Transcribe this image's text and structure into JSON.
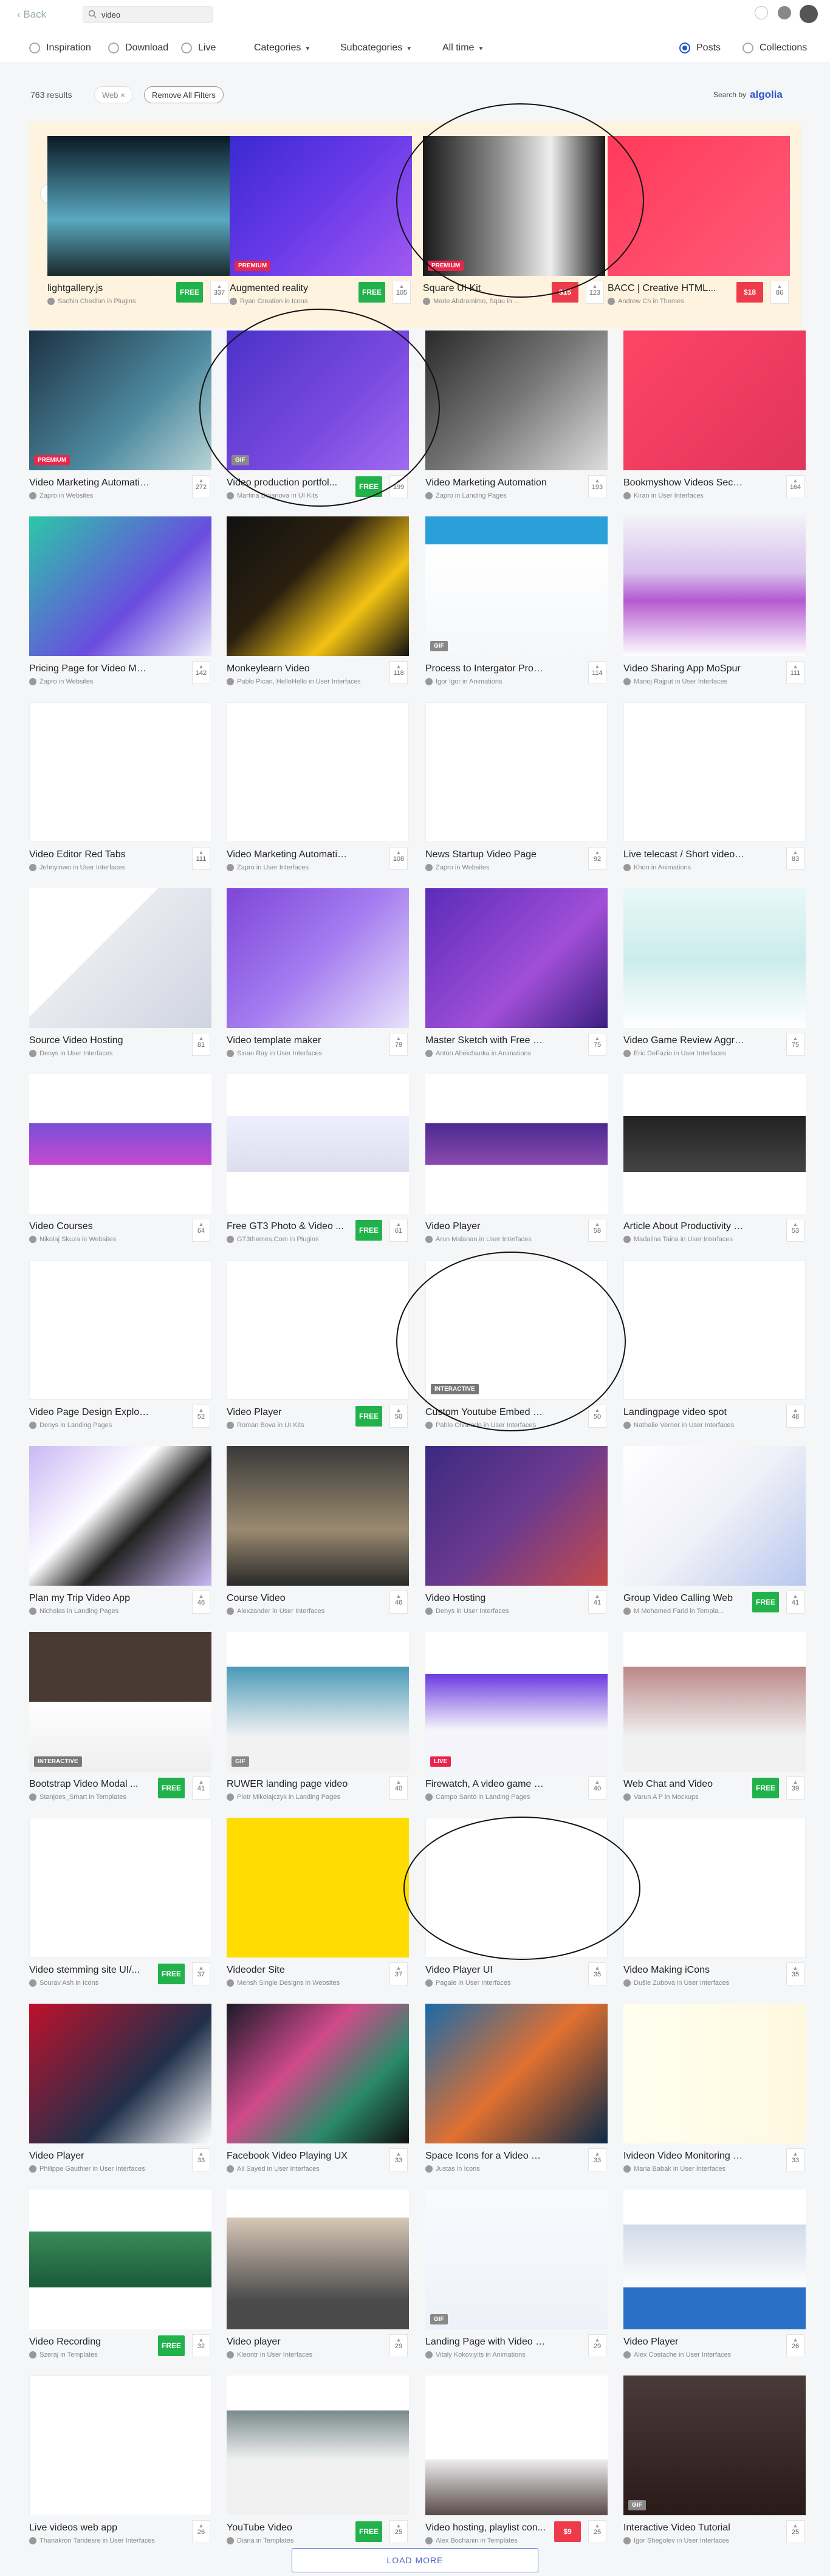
{
  "topbar": {
    "back": "Back",
    "search_value": "video"
  },
  "filters": {
    "radios": [
      "Inspiration",
      "Download",
      "Live"
    ],
    "dropdowns": [
      "Categories",
      "Subcategories",
      "All time"
    ],
    "view": [
      "Posts",
      "Collections"
    ]
  },
  "results": {
    "count": "763 results",
    "chip_web": "Web ×",
    "remove_all": "Remove All Filters",
    "search_by": "Search by",
    "algolia": "algolia"
  },
  "featured": [
    {
      "title": "lightgallery.js",
      "author": "Sachin Chedlon in Plugins",
      "tag": "FREE",
      "votes": "337",
      "badge": ""
    },
    {
      "title": "Augmented reality",
      "author": "Ryan Creation in Icons",
      "tag": "FREE",
      "votes": "105",
      "badge": "PREMIUM"
    },
    {
      "title": "Square UI Kit",
      "author": "Marie Abdramimo, Sqau in ...",
      "tag": "$15",
      "votes": "123",
      "badge": "PREMIUM"
    },
    {
      "title": "BACC | Creative HTML...",
      "author": "Andrew Ch in Themes",
      "tag": "$18",
      "votes": "86",
      "badge": ""
    }
  ],
  "cards": [
    {
      "title": "Video Marketing Automation – F...",
      "author": "Zapro in Websites",
      "tag": "",
      "votes": "272",
      "badge": "PREMIUM"
    },
    {
      "title": "Video production portfol...",
      "author": "Martina Dojanova in UI Kits",
      "tag": "FREE",
      "votes": "199",
      "badge": "GIF"
    },
    {
      "title": "Video Marketing Automation",
      "author": "Zapro in Landing Pages",
      "tag": "",
      "votes": "193",
      "badge": ""
    },
    {
      "title": "Bookmyshow Videos Section",
      "author": "Kiran in User Interfaces",
      "tag": "",
      "votes": "164",
      "badge": ""
    },
    {
      "title": "Pricing Page for Video Marketin...",
      "author": "Zapro in Websites",
      "tag": "",
      "votes": "142",
      "badge": ""
    },
    {
      "title": "Monkeylearn Video",
      "author": "Pablo Picari, HelloHello in User Interfaces",
      "tag": "",
      "votes": "118",
      "badge": ""
    },
    {
      "title": "Process to Intergator Promo Vid...",
      "author": "Igor Igor in Animations",
      "tag": "",
      "votes": "114",
      "badge": "GIF"
    },
    {
      "title": "Video Sharing App MoSpur",
      "author": "Manoj Rajput in User Interfaces",
      "tag": "",
      "votes": "111",
      "badge": ""
    },
    {
      "title": "Video Editor Red Tabs",
      "author": "Johnyinwo in User Interfaces",
      "tag": "",
      "votes": "111",
      "badge": ""
    },
    {
      "title": "Video Marketing Automation an...",
      "author": "Zapro in User Interfaces",
      "tag": "",
      "votes": "108",
      "badge": ""
    },
    {
      "title": "News Startup Video Page",
      "author": "Zapro in Websites",
      "tag": "",
      "votes": "92",
      "badge": ""
    },
    {
      "title": "Live telecast / Short video live A...",
      "author": "Khon in Animations",
      "tag": "",
      "votes": "83",
      "badge": ""
    },
    {
      "title": "Source Video Hosting",
      "author": "Denys in User Interfaces",
      "tag": "",
      "votes": "81",
      "badge": ""
    },
    {
      "title": "Video template maker",
      "author": "Sinan Ray in User Interfaces",
      "tag": "",
      "votes": "79",
      "badge": ""
    },
    {
      "title": "Master Sketch with Free Video T...",
      "author": "Anton Aheichanka in Animations",
      "tag": "",
      "votes": "75",
      "badge": ""
    },
    {
      "title": "Video Game Review Aggregator",
      "author": "Eric DeFazio in User Interfaces",
      "tag": "",
      "votes": "75",
      "badge": ""
    },
    {
      "title": "Video Courses",
      "author": "Nikolaj Skuza in Websites",
      "tag": "",
      "votes": "64",
      "badge": ""
    },
    {
      "title": "Free GT3 Photo & Video ...",
      "author": "GT3themes.Com in Plugins",
      "tag": "FREE",
      "votes": "61",
      "badge": ""
    },
    {
      "title": "Video Player",
      "author": "Arun Malanan in User Interfaces",
      "tag": "",
      "votes": "58",
      "badge": ""
    },
    {
      "title": "Article About Productivity With V...",
      "author": "Madalina Taina in User Interfaces",
      "tag": "",
      "votes": "53",
      "badge": ""
    },
    {
      "title": "Video Page Design Exploration",
      "author": "Denys in Landing Pages",
      "tag": "",
      "votes": "52",
      "badge": ""
    },
    {
      "title": "Video Player",
      "author": "Roman Bova in UI Kits",
      "tag": "FREE",
      "votes": "50",
      "badge": ""
    },
    {
      "title": "Custom Youtube Embed Video P...",
      "author": "Pablo Olvarado in User Interfaces",
      "tag": "",
      "votes": "50",
      "badge": "INTERACTIVE"
    },
    {
      "title": "Landingpage video spot",
      "author": "Nathalie Verner in User Interfaces",
      "tag": "",
      "votes": "48",
      "badge": ""
    },
    {
      "title": "Plan my Trip Video App",
      "author": "Nicholas in Landing Pages",
      "tag": "",
      "votes": "46",
      "badge": ""
    },
    {
      "title": "Course Video",
      "author": "Alexzander in User Interfaces",
      "tag": "",
      "votes": "46",
      "badge": ""
    },
    {
      "title": "Video Hosting",
      "author": "Denys in User Interfaces",
      "tag": "",
      "votes": "41",
      "badge": ""
    },
    {
      "title": "Group Video Calling Web",
      "author": "M Mohamed Farid in Templa...",
      "tag": "FREE",
      "votes": "41",
      "badge": ""
    },
    {
      "title": "Bootstrap Video Modal ...",
      "author": "Stanjoes_Smart in Templates",
      "tag": "FREE",
      "votes": "41",
      "badge": "INTERACTIVE"
    },
    {
      "title": "RUWER landing page video",
      "author": "Piotr Mikolajczyk in Landing Pages",
      "tag": "",
      "votes": "40",
      "badge": "GIF"
    },
    {
      "title": "Firewatch, A video game by cam...",
      "author": "Campo Santo in Landing Pages",
      "tag": "",
      "votes": "40",
      "badge": "LIVE"
    },
    {
      "title": "Web Chat and Video",
      "author": "Varun A P in Mockups",
      "tag": "FREE",
      "votes": "39",
      "badge": ""
    },
    {
      "title": "Video stemming site UI/...",
      "author": "Sourav Ash in Icons",
      "tag": "FREE",
      "votes": "37",
      "badge": ""
    },
    {
      "title": "Videoder Site",
      "author": "Mensh Single Designs in Websites",
      "tag": "",
      "votes": "37",
      "badge": ""
    },
    {
      "title": "Video Player UI",
      "author": "Pagale in User Interfaces",
      "tag": "",
      "votes": "35",
      "badge": ""
    },
    {
      "title": "Video Making iCons",
      "author": "Dušle Zubova in User Interfaces",
      "tag": "",
      "votes": "35",
      "badge": ""
    },
    {
      "title": "Video Player",
      "author": "Philippe Gauthier in User Interfaces",
      "tag": "",
      "votes": "33",
      "badge": ""
    },
    {
      "title": "Facebook Video Playing UX",
      "author": "Ali Sayed in User Interfaces",
      "tag": "",
      "votes": "33",
      "badge": ""
    },
    {
      "title": "Space Icons for a Video Course",
      "author": "Justas in Icons",
      "tag": "",
      "votes": "33",
      "badge": ""
    },
    {
      "title": "Ivideon Video Monitoring Dashb...",
      "author": "Maria Babak in User Interfaces",
      "tag": "",
      "votes": "33",
      "badge": ""
    },
    {
      "title": "Video Recording",
      "author": "Szeraj in Templates",
      "tag": "FREE",
      "votes": "32",
      "badge": ""
    },
    {
      "title": "Video player",
      "author": "Kleontr in User Interfaces",
      "tag": "",
      "votes": "29",
      "badge": ""
    },
    {
      "title": "Landing Page with Video Backgr...",
      "author": "Vitaly Kokoviyits in Animations",
      "tag": "",
      "votes": "29",
      "badge": "GIF"
    },
    {
      "title": "Video Player",
      "author": "Alex Costache in User Interfaces",
      "tag": "",
      "votes": "26",
      "badge": ""
    },
    {
      "title": "Live videos web app",
      "author": "Thanakron Taridesre in User Interfaces",
      "tag": "",
      "votes": "26",
      "badge": ""
    },
    {
      "title": "YouTube Video",
      "author": "Diana in Templates",
      "tag": "FREE",
      "votes": "25",
      "badge": ""
    },
    {
      "title": "Video hosting, playlist con...",
      "author": "Alex Bochanin in Templates",
      "tag": "$9",
      "votes": "25",
      "badge": ""
    },
    {
      "title": "Interactive Video Tutorial",
      "author": "Igor Shegolev in User Interfaces",
      "tag": "",
      "votes": "25",
      "badge": "GIF"
    }
  ],
  "load_more": "LOAD MORE"
}
